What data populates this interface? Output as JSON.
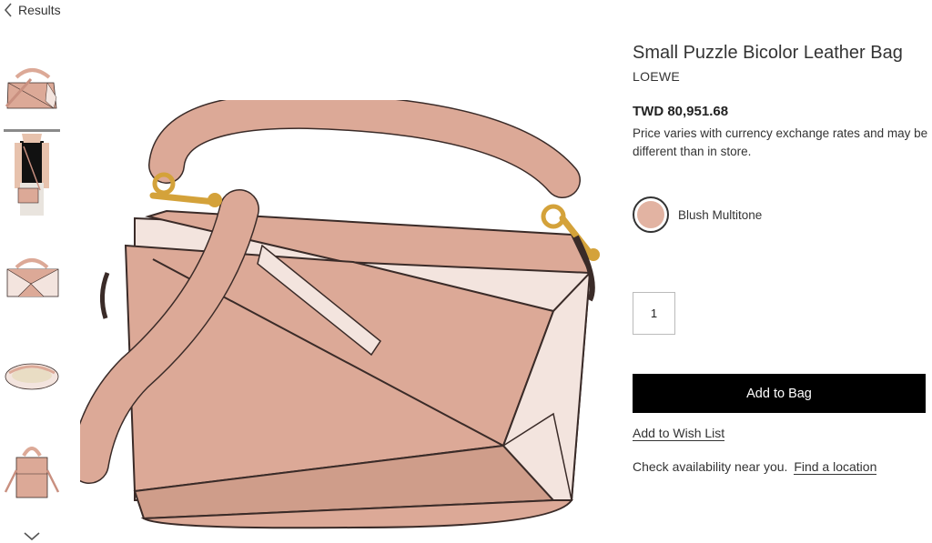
{
  "nav": {
    "back_label": "Results"
  },
  "product": {
    "title": "Small Puzzle Bicolor Leather Bag",
    "brand": "LOEWE",
    "price": "TWD 80,951.68",
    "price_note": "Price varies with currency exchange rates and may be different than in store.",
    "color": {
      "name": "Blush Multitone",
      "hex": "#e2b3a2"
    },
    "quantity": "1"
  },
  "actions": {
    "add_to_bag_label": "Add to Bag",
    "wish_list_label": "Add to Wish List",
    "availability_text": "Check availability near you.",
    "find_location_label": "Find a location"
  },
  "thumbnails": [
    {
      "view": "front"
    },
    {
      "view": "worn-on-model"
    },
    {
      "view": "side"
    },
    {
      "view": "interior"
    },
    {
      "view": "back"
    }
  ],
  "colors": {
    "blush": "#dca997",
    "blush_dark": "#c99080",
    "cream": "#f3e4de",
    "edge": "#3a2b28",
    "hardware": "#d4a23a",
    "button_bg": "#000000"
  }
}
